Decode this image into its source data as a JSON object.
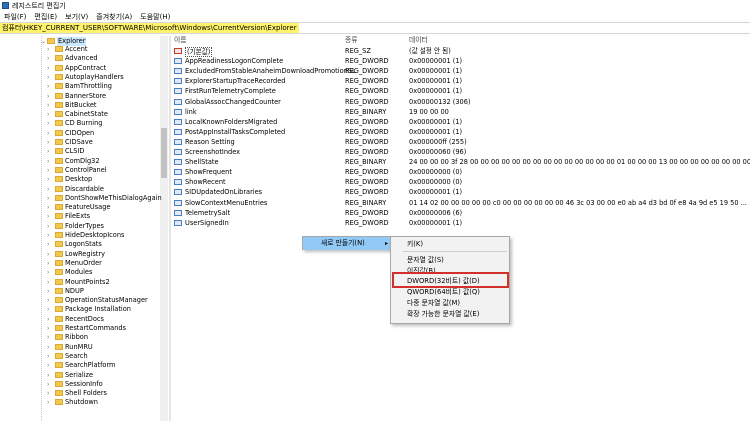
{
  "window": {
    "title": "레지스트리 편집기"
  },
  "menu": [
    "파일(F)",
    "편집(E)",
    "보기(V)",
    "즐겨찾기(A)",
    "도움말(H)"
  ],
  "address": "컴퓨터\\HKEY_CURRENT_USER\\SOFTWARE\\Microsoft\\Windows\\CurrentVersion\\Explorer",
  "tree": {
    "selected": "Explorer",
    "children": [
      "Accent",
      "Advanced",
      "AppContract",
      "AutoplayHandlers",
      "BamThrottling",
      "BannerStore",
      "BitBucket",
      "CabinetState",
      "CD Burning",
      "CIDOpen",
      "CIDSave",
      "CLSID",
      "ComDlg32",
      "ControlPanel",
      "Desktop",
      "Discardable",
      "DontShowMeThisDialogAgain",
      "FeatureUsage",
      "FileExts",
      "FolderTypes",
      "HideDesktopIcons",
      "LogonStats",
      "LowRegistry",
      "MenuOrder",
      "Modules",
      "MountPoints2",
      "NDUP",
      "OperationStatusManager",
      "Package Installation",
      "RecentDocs",
      "RestartCommands",
      "Ribbon",
      "RunMRU",
      "Search",
      "SearchPlatform",
      "Serialize",
      "SessionInfo",
      "Shell Folders",
      "Shutdown"
    ]
  },
  "columns": {
    "name": "이름",
    "type": "종류",
    "data": "데이터"
  },
  "values": [
    {
      "name": "(기본값)",
      "type": "REG_SZ",
      "data": "(값 설정 안 됨)",
      "kind": "string"
    },
    {
      "name": "AppReadinessLogonComplete",
      "type": "REG_DWORD",
      "data": "0x00000001 (1)",
      "kind": "binary"
    },
    {
      "name": "ExcludedFromStableAnaheimDownloadPromotionSL",
      "type": "REG_DWORD",
      "data": "0x00000001 (1)",
      "kind": "binary"
    },
    {
      "name": "ExplorerStartupTraceRecorded",
      "type": "REG_DWORD",
      "data": "0x00000001 (1)",
      "kind": "binary"
    },
    {
      "name": "FirstRunTelemetryComplete",
      "type": "REG_DWORD",
      "data": "0x00000001 (1)",
      "kind": "binary"
    },
    {
      "name": "GlobalAssocChangedCounter",
      "type": "REG_DWORD",
      "data": "0x00000132 (306)",
      "kind": "binary"
    },
    {
      "name": "link",
      "type": "REG_BINARY",
      "data": "19 00 00 00",
      "kind": "binary"
    },
    {
      "name": "LocalKnownFoldersMigrated",
      "type": "REG_DWORD",
      "data": "0x00000001 (1)",
      "kind": "binary"
    },
    {
      "name": "PostAppInstallTasksCompleted",
      "type": "REG_DWORD",
      "data": "0x00000001 (1)",
      "kind": "binary"
    },
    {
      "name": "Reason Setting",
      "type": "REG_DWORD",
      "data": "0x000000ff (255)",
      "kind": "binary"
    },
    {
      "name": "ScreenshotIndex",
      "type": "REG_DWORD",
      "data": "0x00000060 (96)",
      "kind": "binary"
    },
    {
      "name": "ShellState",
      "type": "REG_BINARY",
      "data": "24 00 00 00 3f 28 00 00 00 00 00 00 00 00 00 00 00 00 00 00 01 00 00 00 13 00 00 00 00 00 00 00 00 ...",
      "kind": "binary"
    },
    {
      "name": "ShowFrequent",
      "type": "REG_DWORD",
      "data": "0x00000000 (0)",
      "kind": "binary"
    },
    {
      "name": "ShowRecent",
      "type": "REG_DWORD",
      "data": "0x00000000 (0)",
      "kind": "binary"
    },
    {
      "name": "SIDUpdatedOnLibraries",
      "type": "REG_DWORD",
      "data": "0x00000001 (1)",
      "kind": "binary"
    },
    {
      "name": "SlowContextMenuEntries",
      "type": "REG_BINARY",
      "data": "01 14 02 00 00 00 00 00 c0 00 00 00 00 00 00 46 3c 03 00 00 e0 ab a4 d3 bd 0f e8 4a 9d e5 19 50 ...",
      "kind": "binary"
    },
    {
      "name": "TelemetrySalt",
      "type": "REG_DWORD",
      "data": "0x00000006 (6)",
      "kind": "binary"
    },
    {
      "name": "UserSignedIn",
      "type": "REG_DWORD",
      "data": "0x00000001 (1)",
      "kind": "binary"
    }
  ],
  "context_menu": {
    "new_label": "새로 만들기(N)",
    "submenu": [
      {
        "label": "키(K)"
      },
      {
        "label": "문자열 값(S)"
      },
      {
        "label": "이진값(B)"
      },
      {
        "label": "DWORD(32비트) 값(D)"
      },
      {
        "label": "QWORD(64비트) 값(Q)"
      },
      {
        "label": "다중 문자열 값(M)"
      },
      {
        "label": "확장 가능한 문자열 값(E)"
      }
    ],
    "highlighted": "DWORD(32비트) 값(D)",
    "highlight_color": "#d32f2f"
  },
  "colors": {
    "address_highlight": "#fff36b",
    "menu_hover": "#91c9f7",
    "tree_selected": "#cce8ff"
  }
}
